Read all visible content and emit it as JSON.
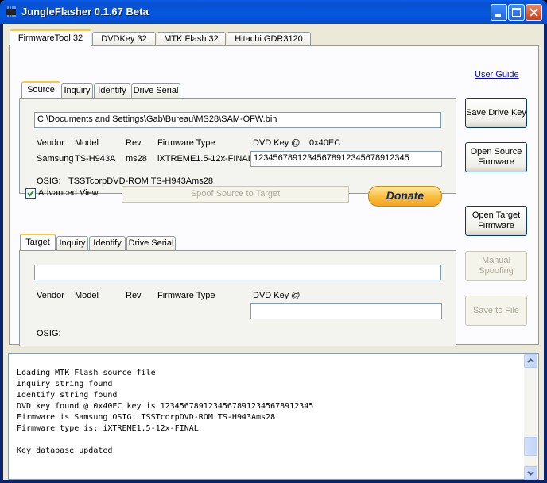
{
  "window": {
    "title": "JungleFlasher 0.1.67 Beta"
  },
  "main_tabs": [
    {
      "label": "FirmwareTool 32"
    },
    {
      "label": "DVDKey 32"
    },
    {
      "label": "MTK Flash 32"
    },
    {
      "label": "Hitachi GDR3120"
    }
  ],
  "source": {
    "tabs": [
      {
        "label": "Source"
      },
      {
        "label": "Inquiry"
      },
      {
        "label": "Identify"
      },
      {
        "label": "Drive Serial"
      }
    ],
    "path": "C:\\Documents and Settings\\Gab\\Bureau\\MS28\\SAM-OFW.bin",
    "labels": {
      "vendor": "Vendor",
      "model": "Model",
      "rev": "Rev",
      "fwtype": "Firmware Type",
      "dvdkey": "DVD Key @",
      "offset": "0x40EC",
      "osig": "OSIG:"
    },
    "values": {
      "vendor": "Samsung",
      "model": "TS-H943A",
      "rev": "ms28",
      "fwtype": "iXTREME1.5-12x-FINAL",
      "dvdkey": "12345678912345678912345678912345",
      "osig": "TSSTcorpDVD-ROM TS-H943Ams28"
    }
  },
  "middle": {
    "advanced_view": "Advanced View",
    "advanced_checked": true,
    "spoof": "Spoof Source to Target",
    "donate": "Donate"
  },
  "target": {
    "tabs": [
      {
        "label": "Target"
      },
      {
        "label": "Inquiry"
      },
      {
        "label": "Identify"
      },
      {
        "label": "Drive Serial"
      }
    ],
    "path": "",
    "labels": {
      "vendor": "Vendor",
      "model": "Model",
      "rev": "Rev",
      "fwtype": "Firmware Type",
      "dvdkey": "DVD Key @",
      "osig": "OSIG:"
    },
    "dvdkey": ""
  },
  "side": {
    "user_guide": "User Guide",
    "save_drive_key": "Save Drive Key",
    "open_source_fw": "Open Source Firmware",
    "open_target_fw": "Open Target Firmware",
    "manual_spoofing": "Manual Spoofing",
    "save_to_file": "Save to File"
  },
  "log": [
    "Loading MTK_Flash source file",
    "Inquiry string found",
    "Identify string found",
    "DVD key found @ 0x40EC key is 12345678912345678912345678912345",
    "Firmware is Samsung OSIG: TSSTcorpDVD-ROM TS-H943Ams28",
    "Firmware type is: iXTREME1.5-12x-FINAL",
    "",
    "Key database updated"
  ]
}
